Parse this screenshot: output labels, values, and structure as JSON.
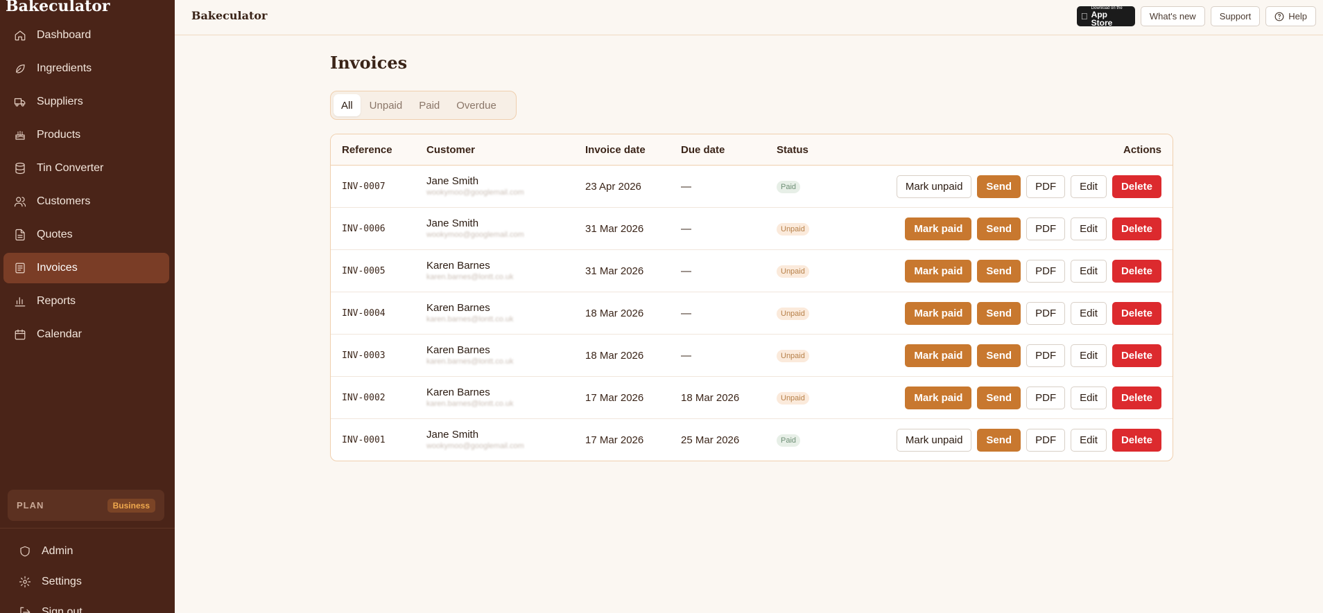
{
  "sidebar": {
    "brand": "Bakeculator",
    "items": [
      {
        "label": "Dashboard",
        "icon": "home-icon"
      },
      {
        "label": "Ingredients",
        "icon": "leaf-icon"
      },
      {
        "label": "Suppliers",
        "icon": "truck-icon"
      },
      {
        "label": "Products",
        "icon": "cake-icon"
      },
      {
        "label": "Tin Converter",
        "icon": "database-icon"
      },
      {
        "label": "Customers",
        "icon": "users-icon"
      },
      {
        "label": "Quotes",
        "icon": "file-icon"
      },
      {
        "label": "Invoices",
        "icon": "receipt-icon",
        "active": true
      },
      {
        "label": "Reports",
        "icon": "bar-chart-icon"
      },
      {
        "label": "Calendar",
        "icon": "calendar-icon"
      }
    ],
    "plan": {
      "label": "PLAN",
      "value": "Business"
    },
    "bottom": [
      {
        "label": "Admin",
        "icon": "shield-icon"
      },
      {
        "label": "Settings",
        "icon": "gear-icon"
      },
      {
        "label": "Sign out",
        "icon": "sign-out-icon"
      }
    ]
  },
  "topbar": {
    "title": "Bakeculator",
    "appstore_small": "Download on the",
    "appstore_big": "App Store",
    "whats_new": "What's new",
    "support": "Support",
    "help": "Help"
  },
  "page": {
    "title": "Invoices",
    "tabs": [
      "All",
      "Unpaid",
      "Paid",
      "Overdue"
    ],
    "active_tab": "All"
  },
  "table": {
    "headers": {
      "reference": "Reference",
      "customer": "Customer",
      "invoice_date": "Invoice date",
      "due_date": "Due date",
      "status": "Status",
      "actions": "Actions"
    },
    "action_labels": {
      "mark_unpaid": "Mark unpaid",
      "mark_paid": "Mark paid",
      "send": "Send",
      "pdf": "PDF",
      "edit": "Edit",
      "delete": "Delete"
    },
    "rows": [
      {
        "ref": "INV-0007",
        "name": "Jane Smith",
        "email": "wookymoo@googlemail.com",
        "invoice_date": "23 Apr 2026",
        "due_date": "—",
        "status": "Paid"
      },
      {
        "ref": "INV-0006",
        "name": "Jane Smith",
        "email": "wookymoo@googlemail.com",
        "invoice_date": "31 Mar 2026",
        "due_date": "—",
        "status": "Unpaid"
      },
      {
        "ref": "INV-0005",
        "name": "Karen Barnes",
        "email": "karen.barnes@lontt.co.uk",
        "invoice_date": "31 Mar 2026",
        "due_date": "—",
        "status": "Unpaid"
      },
      {
        "ref": "INV-0004",
        "name": "Karen Barnes",
        "email": "karen.barnes@lontt.co.uk",
        "invoice_date": "18 Mar 2026",
        "due_date": "—",
        "status": "Unpaid"
      },
      {
        "ref": "INV-0003",
        "name": "Karen Barnes",
        "email": "karen.barnes@lontt.co.uk",
        "invoice_date": "18 Mar 2026",
        "due_date": "—",
        "status": "Unpaid"
      },
      {
        "ref": "INV-0002",
        "name": "Karen Barnes",
        "email": "karen.barnes@lontt.co.uk",
        "invoice_date": "17 Mar 2026",
        "due_date": "18 Mar 2026",
        "status": "Unpaid"
      },
      {
        "ref": "INV-0001",
        "name": "Jane Smith",
        "email": "wookymoo@googlemail.com",
        "invoice_date": "17 Mar 2026",
        "due_date": "25 Mar 2026",
        "status": "Paid"
      }
    ]
  },
  "colors": {
    "sidebar_bg": "#4a2418",
    "sidebar_active": "#7a3d26",
    "accent": "#c8782f",
    "danger": "#dc2a2e",
    "page_bg": "#fbf7f2"
  }
}
